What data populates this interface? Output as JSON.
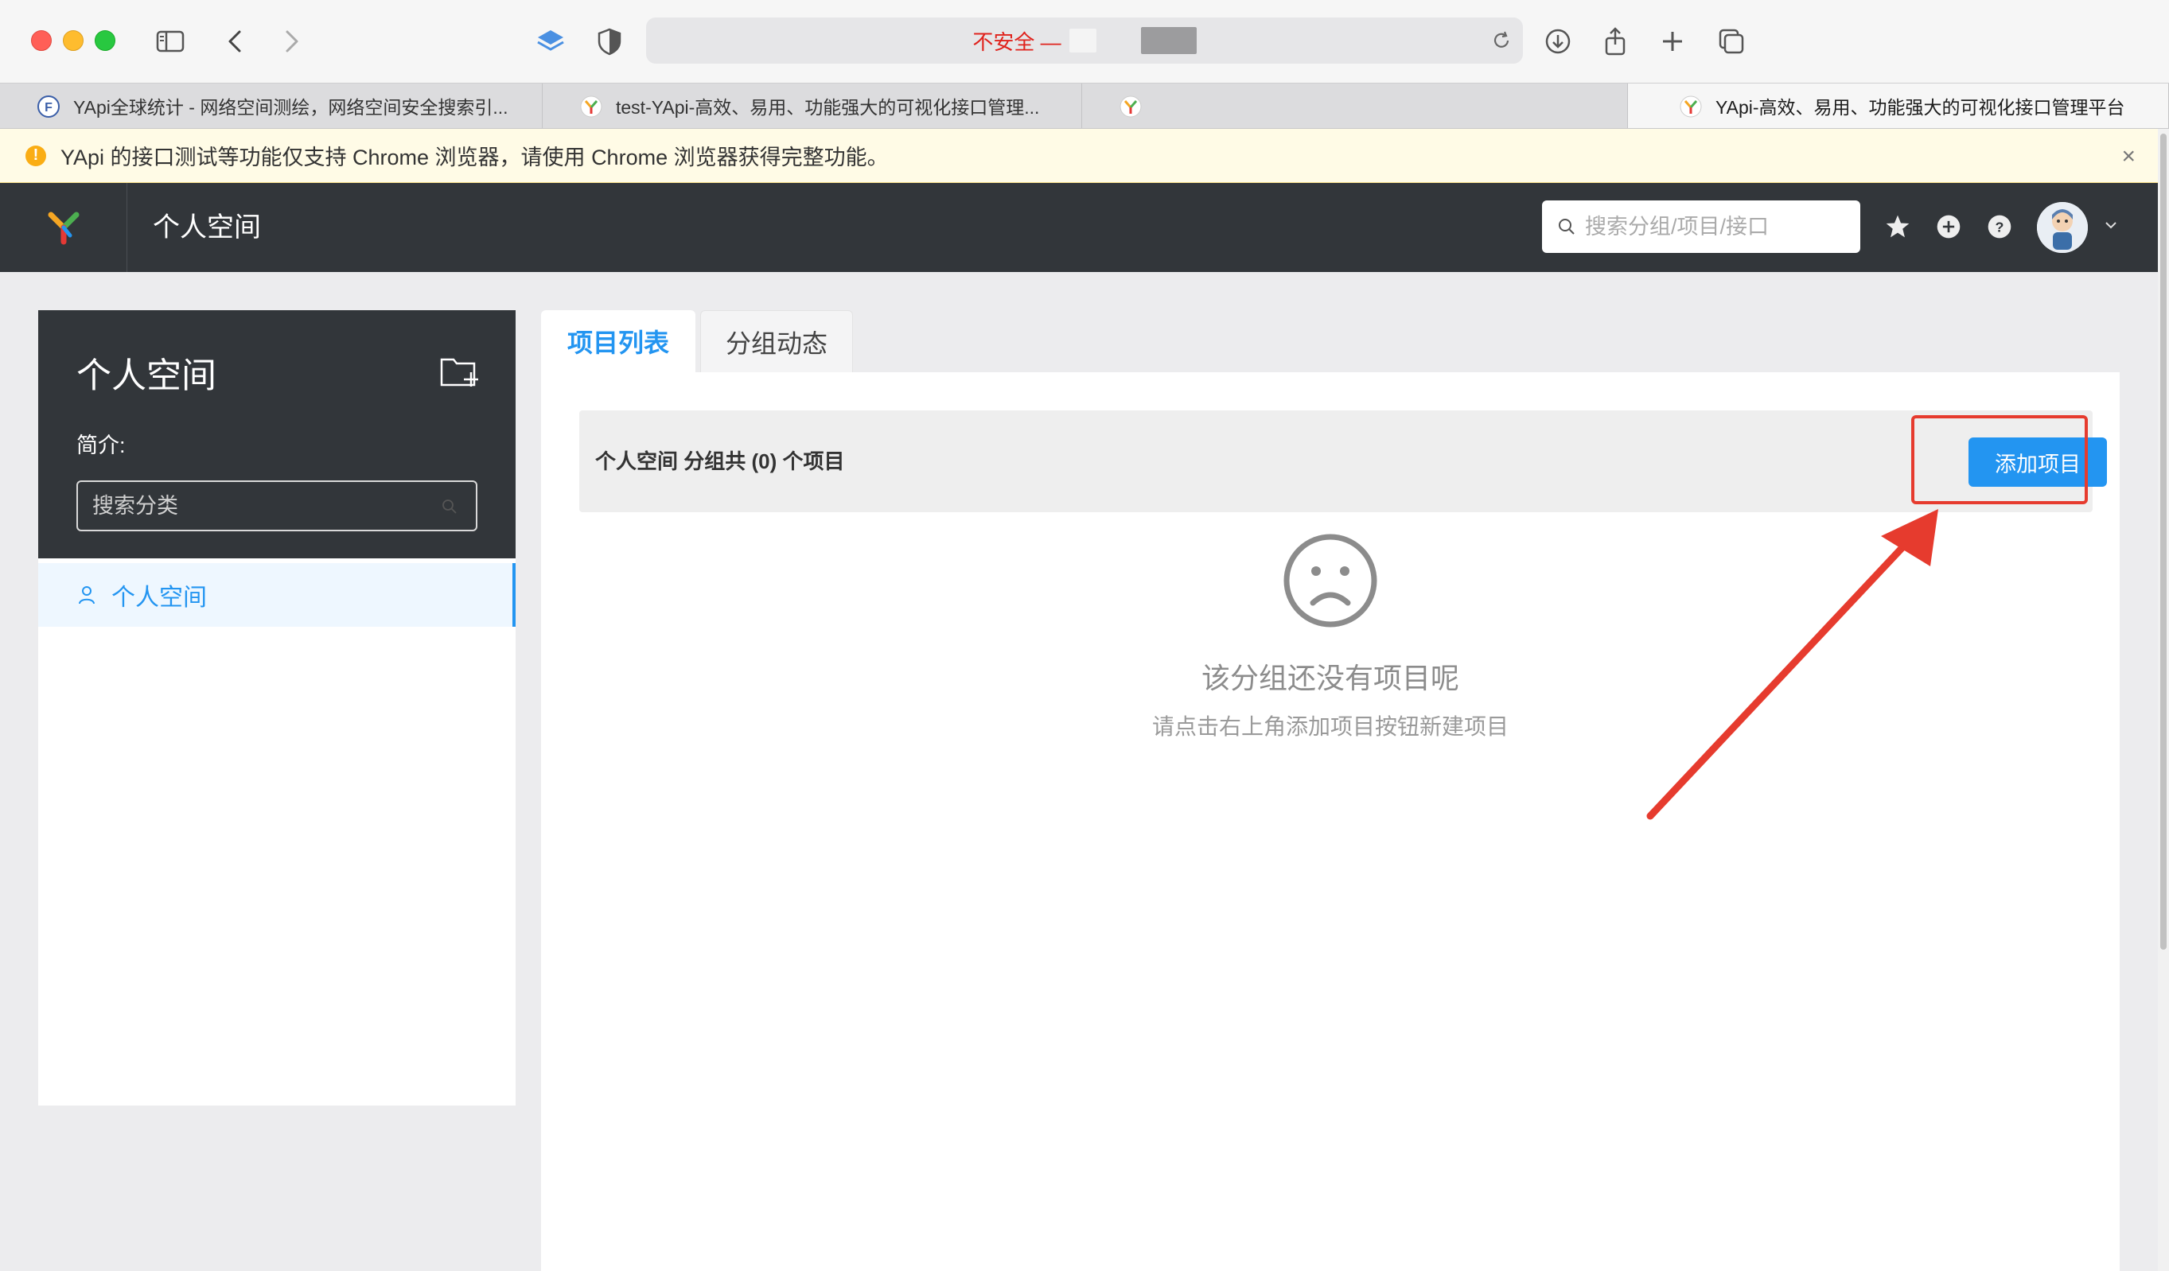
{
  "browser": {
    "address": "不安全 —",
    "tabs": [
      {
        "label": "YApi全球统计 - 网络空间测绘，网络空间安全搜索引...",
        "icon": "fofa-icon"
      },
      {
        "label": "test-YApi-高效、易用、功能强大的可视化接口管理...",
        "icon": "yapi-icon"
      },
      {
        "label": "",
        "icon": "yapi-icon"
      },
      {
        "label": "YApi-高效、易用、功能强大的可视化接口管理平台",
        "icon": "yapi-icon"
      }
    ]
  },
  "banner": {
    "text": "YApi 的接口测试等功能仅支持 Chrome 浏览器，请使用 Chrome 浏览器获得完整功能。",
    "close": "×"
  },
  "header": {
    "title": "个人空间",
    "search_placeholder": "搜索分组/项目/接口"
  },
  "sidebar": {
    "title": "个人空间",
    "desc_label": "简介:",
    "search_placeholder": "搜索分类",
    "items": [
      {
        "label": "个人空间"
      }
    ]
  },
  "main": {
    "tabs": [
      {
        "label": "项目列表"
      },
      {
        "label": "分组动态"
      }
    ],
    "count_text": "个人空间 分组共 (0) 个项目",
    "add_button": "添加项目",
    "empty_title": "该分组还没有项目呢",
    "empty_desc": "请点击右上角添加项目按钮新建项目"
  },
  "colors": {
    "primary": "#2395f1",
    "header_bg": "#32363a",
    "annotation": "#e63b2e"
  }
}
